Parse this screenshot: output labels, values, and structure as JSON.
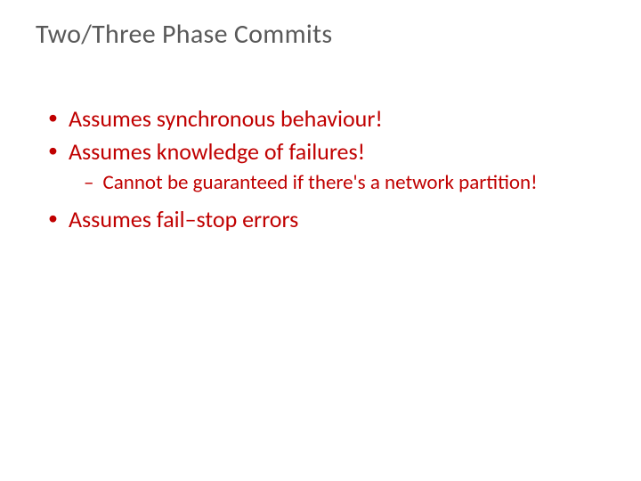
{
  "slide": {
    "title": "Two/Three Phase Commits",
    "bullets": [
      {
        "level": 1,
        "text": "Assumes synchronous behaviour!"
      },
      {
        "level": 1,
        "text": "Assumes knowledge of failures!"
      },
      {
        "level": 2,
        "text": "Cannot be guaranteed if there's a network partition!"
      },
      {
        "level": 1,
        "text": "Assumes fail–stop errors"
      }
    ]
  },
  "markers": {
    "l1": "•",
    "l2": "–"
  }
}
